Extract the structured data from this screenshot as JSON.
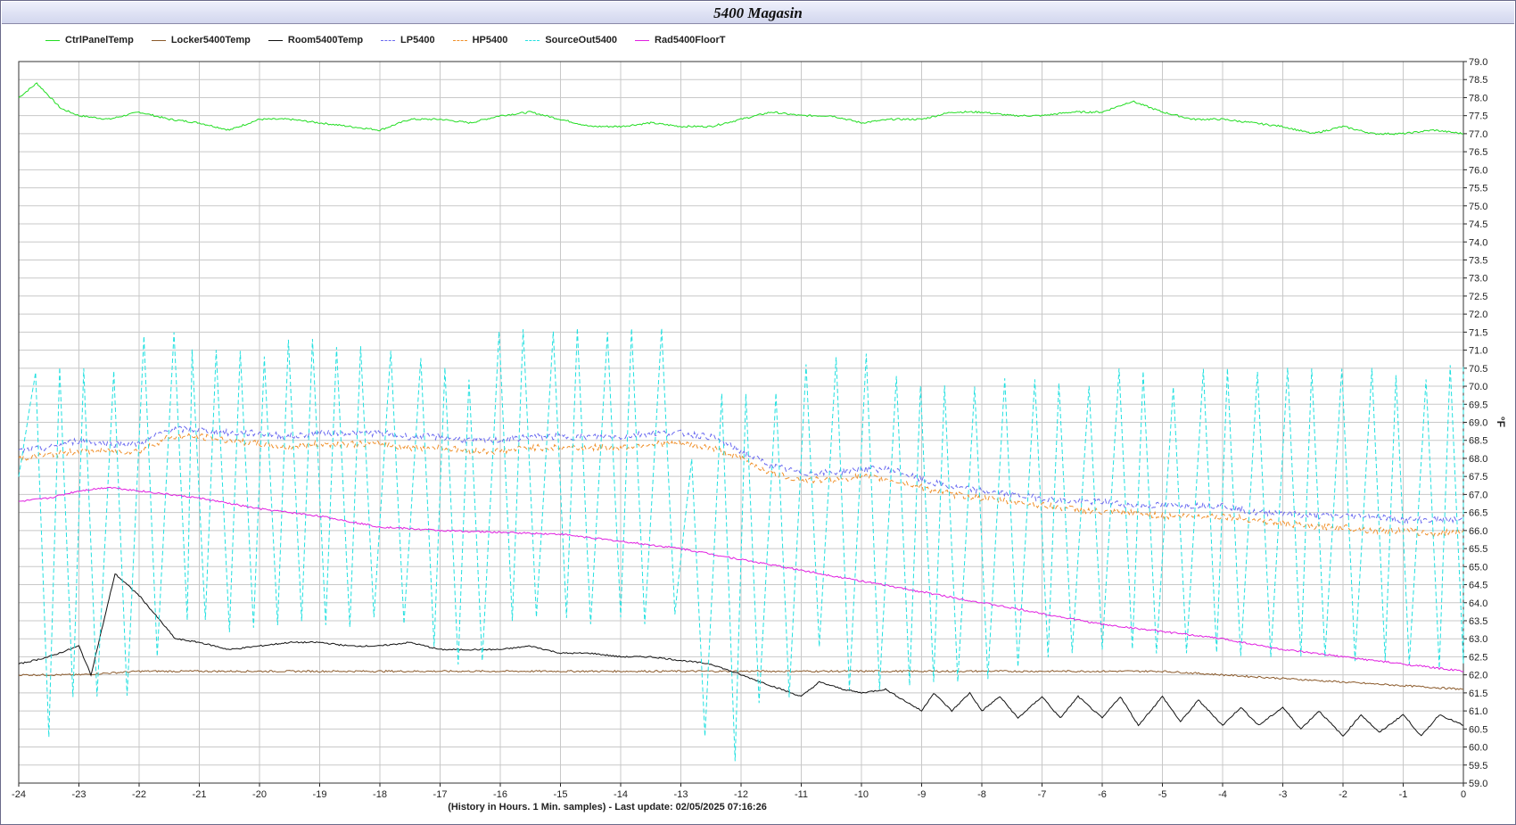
{
  "title": "5400 Magasin",
  "legend": [
    {
      "name": "CtrlPanelTemp",
      "color": "#22dd22",
      "dash": false
    },
    {
      "name": "Locker5400Temp",
      "color": "#8b5a2b",
      "dash": false
    },
    {
      "name": "Room5400Temp",
      "color": "#111111",
      "dash": false
    },
    {
      "name": "LP5400",
      "color": "#6a6af0",
      "dash": true
    },
    {
      "name": "HP5400",
      "color": "#f0902a",
      "dash": true
    },
    {
      "name": "SourceOut5400",
      "color": "#22e0e0",
      "dash": true
    },
    {
      "name": "Rad5400FloorT",
      "color": "#e020e0",
      "dash": false
    }
  ],
  "x_caption": "(History in Hours. 1 Min. samples) - Last update: 02/05/2025 07:16:26",
  "chart_data": {
    "type": "line",
    "title": "5400 Magasin",
    "xlabel": "(History in Hours. 1 Min. samples) - Last update: 02/05/2025 07:16:26",
    "ylabel": "°F",
    "xlim": [
      -24,
      0
    ],
    "ylim": [
      59.0,
      79.0
    ],
    "x_ticks": [
      "-24",
      "-23",
      "-22",
      "-21",
      "-20",
      "-19",
      "-18",
      "-17",
      "-16",
      "-15",
      "-14",
      "-13",
      "-12",
      "-11",
      "-10",
      "-9",
      "-8",
      "-7",
      "-6",
      "-5",
      "-4",
      "-3",
      "-2",
      "-1",
      "0"
    ],
    "y_ticks": [
      "59.0",
      "59.5",
      "60.0",
      "60.5",
      "61.0",
      "61.5",
      "62.0",
      "62.5",
      "63.0",
      "63.5",
      "64.0",
      "64.5",
      "65.0",
      "65.5",
      "66.0",
      "66.5",
      "67.0",
      "67.5",
      "68.0",
      "68.5",
      "69.0",
      "69.5",
      "70.0",
      "70.5",
      "71.0",
      "71.5",
      "72.0",
      "72.5",
      "73.0",
      "73.5",
      "74.0",
      "74.5",
      "75.0",
      "75.5",
      "76.0",
      "76.5",
      "77.0",
      "77.5",
      "78.0",
      "78.5",
      "79.0"
    ],
    "y_axis_side": "right",
    "grid": true,
    "legend_position": "top",
    "series": [
      {
        "name": "CtrlPanelTemp",
        "color": "#22dd22",
        "dash": false,
        "x": [
          -24,
          -23.7,
          -23.3,
          -23,
          -22.5,
          -22,
          -21.5,
          -21,
          -20.5,
          -20,
          -19.5,
          -19,
          -18.5,
          -18,
          -17.5,
          -17,
          -16.5,
          -16,
          -15.5,
          -15,
          -14.5,
          -14,
          -13.5,
          -13,
          -12.5,
          -12,
          -11.5,
          -11,
          -10.5,
          -10,
          -9.5,
          -9,
          -8.5,
          -8,
          -7.5,
          -7,
          -6.5,
          -6,
          -5.5,
          -5,
          -4.5,
          -4,
          -3.5,
          -3,
          -2.5,
          -2,
          -1.5,
          -1,
          -0.5,
          0
        ],
        "y": [
          78.0,
          78.4,
          77.7,
          77.5,
          77.4,
          77.6,
          77.4,
          77.3,
          77.1,
          77.4,
          77.4,
          77.3,
          77.2,
          77.1,
          77.4,
          77.4,
          77.3,
          77.5,
          77.6,
          77.4,
          77.2,
          77.2,
          77.3,
          77.2,
          77.2,
          77.4,
          77.6,
          77.5,
          77.5,
          77.3,
          77.4,
          77.4,
          77.6,
          77.6,
          77.5,
          77.5,
          77.6,
          77.6,
          77.9,
          77.6,
          77.4,
          77.4,
          77.3,
          77.2,
          77.0,
          77.2,
          77.0,
          77.0,
          77.1,
          77.0
        ]
      },
      {
        "name": "Locker5400Temp",
        "color": "#8b5a2b",
        "dash": false,
        "x": [
          -24,
          -23,
          -22,
          -21,
          -20,
          -19,
          -18,
          -17,
          -16,
          -15,
          -14,
          -13,
          -12,
          -11,
          -10,
          -9,
          -8,
          -7,
          -6,
          -5,
          -4,
          -3,
          -2,
          -1,
          0
        ],
        "y": [
          62.0,
          62.0,
          62.1,
          62.1,
          62.1,
          62.1,
          62.1,
          62.1,
          62.1,
          62.1,
          62.1,
          62.1,
          62.1,
          62.1,
          62.1,
          62.1,
          62.1,
          62.1,
          62.1,
          62.1,
          62.0,
          61.9,
          61.8,
          61.7,
          61.6
        ]
      },
      {
        "name": "Room5400Temp",
        "color": "#111111",
        "dash": false,
        "x": [
          -24,
          -23.5,
          -23,
          -22.8,
          -22.4,
          -22,
          -21.7,
          -21.4,
          -21,
          -20.5,
          -20,
          -19.5,
          -19,
          -18.5,
          -18,
          -17.5,
          -17,
          -16.5,
          -16,
          -15.5,
          -15,
          -14.5,
          -14,
          -13.5,
          -13,
          -12.5,
          -12,
          -11.5,
          -11,
          -10.7,
          -10.3,
          -10,
          -9.6,
          -9.3,
          -9,
          -8.8,
          -8.5,
          -8.2,
          -8,
          -7.7,
          -7.4,
          -7,
          -6.7,
          -6.4,
          -6,
          -5.7,
          -5.4,
          -5,
          -4.7,
          -4.4,
          -4,
          -3.7,
          -3.4,
          -3,
          -2.7,
          -2.4,
          -2,
          -1.7,
          -1.4,
          -1,
          -0.7,
          -0.4,
          0
        ],
        "y": [
          62.3,
          62.5,
          62.8,
          62.0,
          64.8,
          64.2,
          63.6,
          63.0,
          62.9,
          62.7,
          62.8,
          62.9,
          62.9,
          62.8,
          62.8,
          62.9,
          62.7,
          62.7,
          62.7,
          62.8,
          62.6,
          62.6,
          62.5,
          62.5,
          62.4,
          62.3,
          62.0,
          61.7,
          61.4,
          61.8,
          61.6,
          61.5,
          61.6,
          61.3,
          61.0,
          61.5,
          61.0,
          61.5,
          61.0,
          61.4,
          60.8,
          61.4,
          60.8,
          61.4,
          60.8,
          61.4,
          60.6,
          61.4,
          60.7,
          61.3,
          60.6,
          61.1,
          60.6,
          61.1,
          60.5,
          61.0,
          60.3,
          60.9,
          60.4,
          60.9,
          60.3,
          60.9,
          60.6
        ]
      },
      {
        "name": "LP5400",
        "color": "#6a6af0",
        "dash": true,
        "x": [
          -24,
          -23.5,
          -23,
          -22.5,
          -22,
          -21.5,
          -21,
          -20.5,
          -20,
          -19.5,
          -19,
          -18.5,
          -18,
          -17.5,
          -17,
          -16.5,
          -16,
          -15.5,
          -15,
          -14.5,
          -14,
          -13.5,
          -13,
          -12.5,
          -12,
          -11.5,
          -11,
          -10.5,
          -10,
          -9.5,
          -9,
          -8.5,
          -8,
          -7.5,
          -7,
          -6.5,
          -6,
          -5.5,
          -5,
          -4.5,
          -4,
          -3.5,
          -3,
          -2.5,
          -2,
          -1.5,
          -1,
          -0.5,
          0
        ],
        "y": [
          68.2,
          68.3,
          68.5,
          68.4,
          68.4,
          68.8,
          68.8,
          68.7,
          68.7,
          68.6,
          68.7,
          68.7,
          68.7,
          68.6,
          68.6,
          68.5,
          68.5,
          68.6,
          68.6,
          68.6,
          68.6,
          68.7,
          68.7,
          68.6,
          68.2,
          67.8,
          67.6,
          67.6,
          67.7,
          67.7,
          67.4,
          67.2,
          67.1,
          67.0,
          66.9,
          66.8,
          66.8,
          66.7,
          66.7,
          66.7,
          66.7,
          66.5,
          66.5,
          66.4,
          66.4,
          66.4,
          66.3,
          66.3,
          66.3
        ]
      },
      {
        "name": "HP5400",
        "color": "#f0902a",
        "dash": true,
        "x": [
          -24,
          -23.5,
          -23,
          -22.5,
          -22,
          -21.5,
          -21,
          -20.5,
          -20,
          -19.5,
          -19,
          -18.5,
          -18,
          -17.5,
          -17,
          -16.5,
          -16,
          -15.5,
          -15,
          -14.5,
          -14,
          -13.5,
          -13,
          -12.5,
          -12,
          -11.5,
          -11,
          -10.5,
          -10,
          -9.5,
          -9,
          -8.5,
          -8,
          -7.5,
          -7,
          -6.5,
          -6,
          -5.5,
          -5,
          -4.5,
          -4,
          -3.5,
          -3,
          -2.5,
          -2,
          -1.5,
          -1,
          -0.5,
          0
        ],
        "y": [
          68.0,
          68.1,
          68.2,
          68.2,
          68.2,
          68.6,
          68.6,
          68.5,
          68.4,
          68.3,
          68.4,
          68.4,
          68.4,
          68.3,
          68.3,
          68.2,
          68.2,
          68.3,
          68.3,
          68.3,
          68.3,
          68.4,
          68.4,
          68.3,
          68.0,
          67.6,
          67.4,
          67.4,
          67.5,
          67.4,
          67.2,
          67.0,
          66.9,
          66.8,
          66.7,
          66.6,
          66.5,
          66.5,
          66.4,
          66.4,
          66.4,
          66.3,
          66.2,
          66.1,
          66.1,
          66.0,
          66.0,
          65.9,
          66.0
        ]
      },
      {
        "name": "SourceOut5400",
        "color": "#22e0e0",
        "dash": true,
        "cycle_hours": [
          -23.6,
          -23.2,
          -22.8,
          -22.3,
          -21.8,
          -21.3,
          -21.0,
          -20.6,
          -20.2,
          -19.8,
          -19.4,
          -19.0,
          -18.6,
          -18.2,
          -17.7,
          -17.2,
          -16.8,
          -16.4,
          -15.9,
          -15.5,
          -15.0,
          -14.6,
          -14.1,
          -13.7,
          -13.2,
          -12.7,
          -12.2,
          -11.8,
          -11.3,
          -10.8,
          -10.3,
          -9.8,
          -9.3,
          -8.9,
          -8.5,
          -8.0,
          -7.5,
          -7.0,
          -6.6,
          -6.1,
          -5.6,
          -5.2,
          -4.7,
          -4.2,
          -3.8,
          -3.3,
          -2.8,
          -2.4,
          -1.9,
          -1.4,
          -1.0,
          -0.5,
          -0.1
        ],
        "peaks": [
          70.4,
          70.5,
          70.5,
          70.4,
          71.4,
          71.5,
          71.0,
          71.0,
          71.0,
          70.8,
          71.3,
          71.3,
          71.1,
          71.1,
          71.0,
          70.8,
          70.5,
          70.2,
          71.5,
          71.6,
          71.5,
          71.6,
          71.5,
          71.6,
          71.6,
          68.0,
          69.8,
          69.8,
          69.8,
          70.6,
          70.8,
          70.9,
          70.3,
          70.0,
          70.0,
          70.0,
          70.2,
          70.2,
          70.1,
          70.0,
          70.5,
          70.4,
          70.0,
          70.5,
          70.5,
          70.4,
          70.5,
          70.5,
          70.5,
          70.5,
          70.3,
          70.2,
          70.6
        ],
        "troughs": [
          60.3,
          61.4,
          61.4,
          61.4,
          62.5,
          63.5,
          63.5,
          63.2,
          63.3,
          63.4,
          63.5,
          63.4,
          63.3,
          63.6,
          63.4,
          62.8,
          62.3,
          62.4,
          63.5,
          63.6,
          63.6,
          63.4,
          63.6,
          63.4,
          63.7,
          60.3,
          59.6,
          61.2,
          61.4,
          62.8,
          61.6,
          61.6,
          61.7,
          61.8,
          61.8,
          61.9,
          62.2,
          62.5,
          62.6,
          62.7,
          62.7,
          62.6,
          62.6,
          62.6,
          62.5,
          62.5,
          62.5,
          62.5,
          62.4,
          62.4,
          62.3,
          62.2,
          62.3
        ]
      },
      {
        "name": "Rad5400FloorT",
        "color": "#e020e0",
        "dash": false,
        "x": [
          -24,
          -23.5,
          -23,
          -22.5,
          -22,
          -21.5,
          -21,
          -20,
          -19,
          -18,
          -17,
          -16,
          -15,
          -14,
          -13,
          -12,
          -11,
          -10,
          -9,
          -8,
          -7,
          -6,
          -5,
          -4,
          -3,
          -2,
          -1,
          0
        ],
        "y": [
          66.8,
          66.9,
          67.1,
          67.2,
          67.1,
          67.0,
          66.9,
          66.6,
          66.4,
          66.1,
          66.0,
          65.95,
          65.9,
          65.7,
          65.5,
          65.2,
          64.9,
          64.6,
          64.3,
          64.0,
          63.7,
          63.4,
          63.2,
          63.0,
          62.7,
          62.5,
          62.3,
          62.1
        ]
      }
    ]
  }
}
